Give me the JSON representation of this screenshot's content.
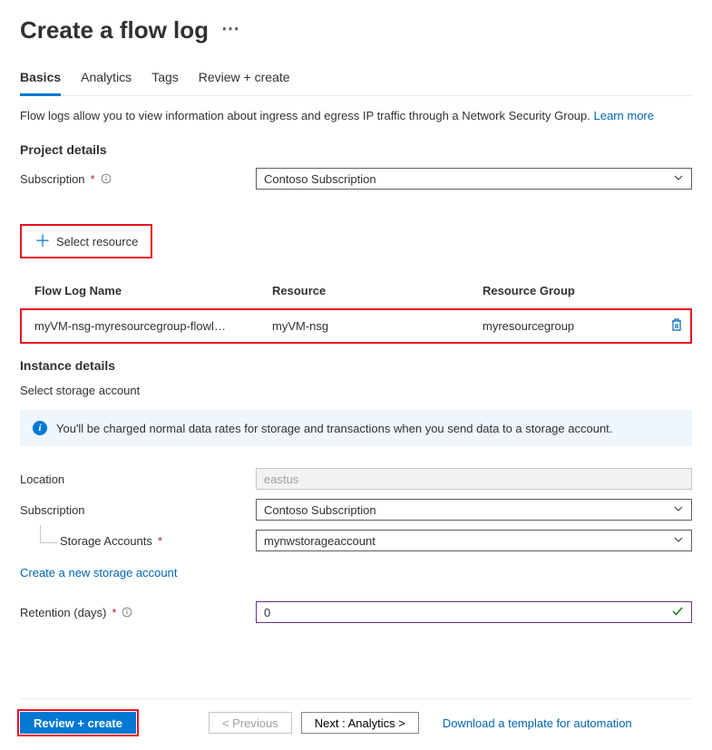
{
  "page": {
    "title": "Create a flow log"
  },
  "tabs": {
    "basics": "Basics",
    "analytics": "Analytics",
    "tags": "Tags",
    "review": "Review + create"
  },
  "description": {
    "text": "Flow logs allow you to view information about ingress and egress IP traffic through a Network Security Group.  ",
    "learn_more": "Learn more"
  },
  "project_details": {
    "title": "Project details",
    "subscription_label": "Subscription",
    "subscription_value": "Contoso Subscription"
  },
  "select_resource": {
    "button_label": "Select resource"
  },
  "resource_table": {
    "headers": {
      "name": "Flow Log Name",
      "resource": "Resource",
      "group": "Resource Group"
    },
    "row": {
      "name": "myVM-nsg-myresourcegroup-flowl…",
      "resource": "myVM-nsg",
      "group": "myresourcegroup"
    }
  },
  "instance_details": {
    "title": "Instance details",
    "subheading": "Select storage account"
  },
  "info_banner": {
    "text": "You'll be charged normal data rates for storage and transactions when you send data to a storage account."
  },
  "storage": {
    "location_label": "Location",
    "location_value": "eastus",
    "subscription_label": "Subscription",
    "subscription_value": "Contoso Subscription",
    "accounts_label": "Storage Accounts",
    "accounts_value": "mynwstorageaccount",
    "create_link": "Create a new storage account",
    "retention_label": "Retention (days)",
    "retention_value": "0"
  },
  "footer": {
    "review": "Review + create",
    "previous": "< Previous",
    "next": "Next : Analytics >",
    "download": "Download a template for automation"
  }
}
